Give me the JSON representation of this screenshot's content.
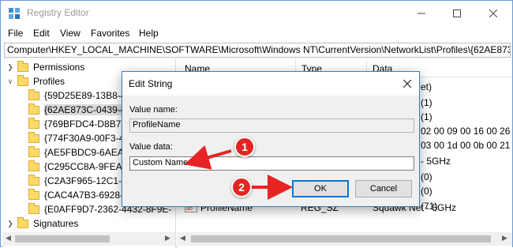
{
  "window": {
    "title": "Registry Editor"
  },
  "menu": [
    "File",
    "Edit",
    "View",
    "Favorites",
    "Help"
  ],
  "address": "Computer\\HKEY_LOCAL_MACHINE\\SOFTWARE\\Microsoft\\Windows NT\\CurrentVersion\\NetworkList\\Profiles\\{62AE873C",
  "tree": {
    "items": [
      {
        "label": "Permissions",
        "level": 1,
        "expanded": false
      },
      {
        "label": "Profiles",
        "level": 1,
        "expanded": true
      },
      {
        "label": "{59D25E89-13B8-45",
        "level": 2
      },
      {
        "label": "{62AE873C-0439-45",
        "level": 2,
        "selected": true
      },
      {
        "label": "{769BFDC4-D8B7-45",
        "level": 2
      },
      {
        "label": "{774F30A9-00F3-4C",
        "level": 2
      },
      {
        "label": "{AE5FBDC9-6AEA-4",
        "level": 2
      },
      {
        "label": "{C295CC8A-9FEA-4",
        "level": 2
      },
      {
        "label": "{C2A3F965-12C1-4",
        "level": 2
      },
      {
        "label": "{CAC4A7B3-6928-4",
        "level": 2
      },
      {
        "label": "{E0AFF9D7-2362-4432-8F9E-",
        "level": 2
      },
      {
        "label": "Signatures",
        "level": 1,
        "expanded": false
      }
    ]
  },
  "list": {
    "columns": [
      "Name",
      "Type",
      "Data"
    ],
    "data_fragments": [
      "et)",
      "(1)",
      "(1)",
      "02 00 09 00 16 00 26 00",
      "03 00 1d 00 0b 00 21 00",
      "- 5GHz",
      "(0)",
      "(0)",
      "(71)"
    ],
    "last_row": {
      "name": "ProfileName",
      "type": "REG_SZ",
      "data": "Squawk Net - 5GHz"
    }
  },
  "dialog": {
    "title": "Edit String",
    "value_name_label": "Value name:",
    "value_name": "ProfileName",
    "value_data_label": "Value data:",
    "value_data": "Custom Name",
    "ok_label": "OK",
    "cancel_label": "Cancel"
  },
  "annotations": {
    "step1": "1",
    "step2": "2",
    "color": "#e62424"
  }
}
